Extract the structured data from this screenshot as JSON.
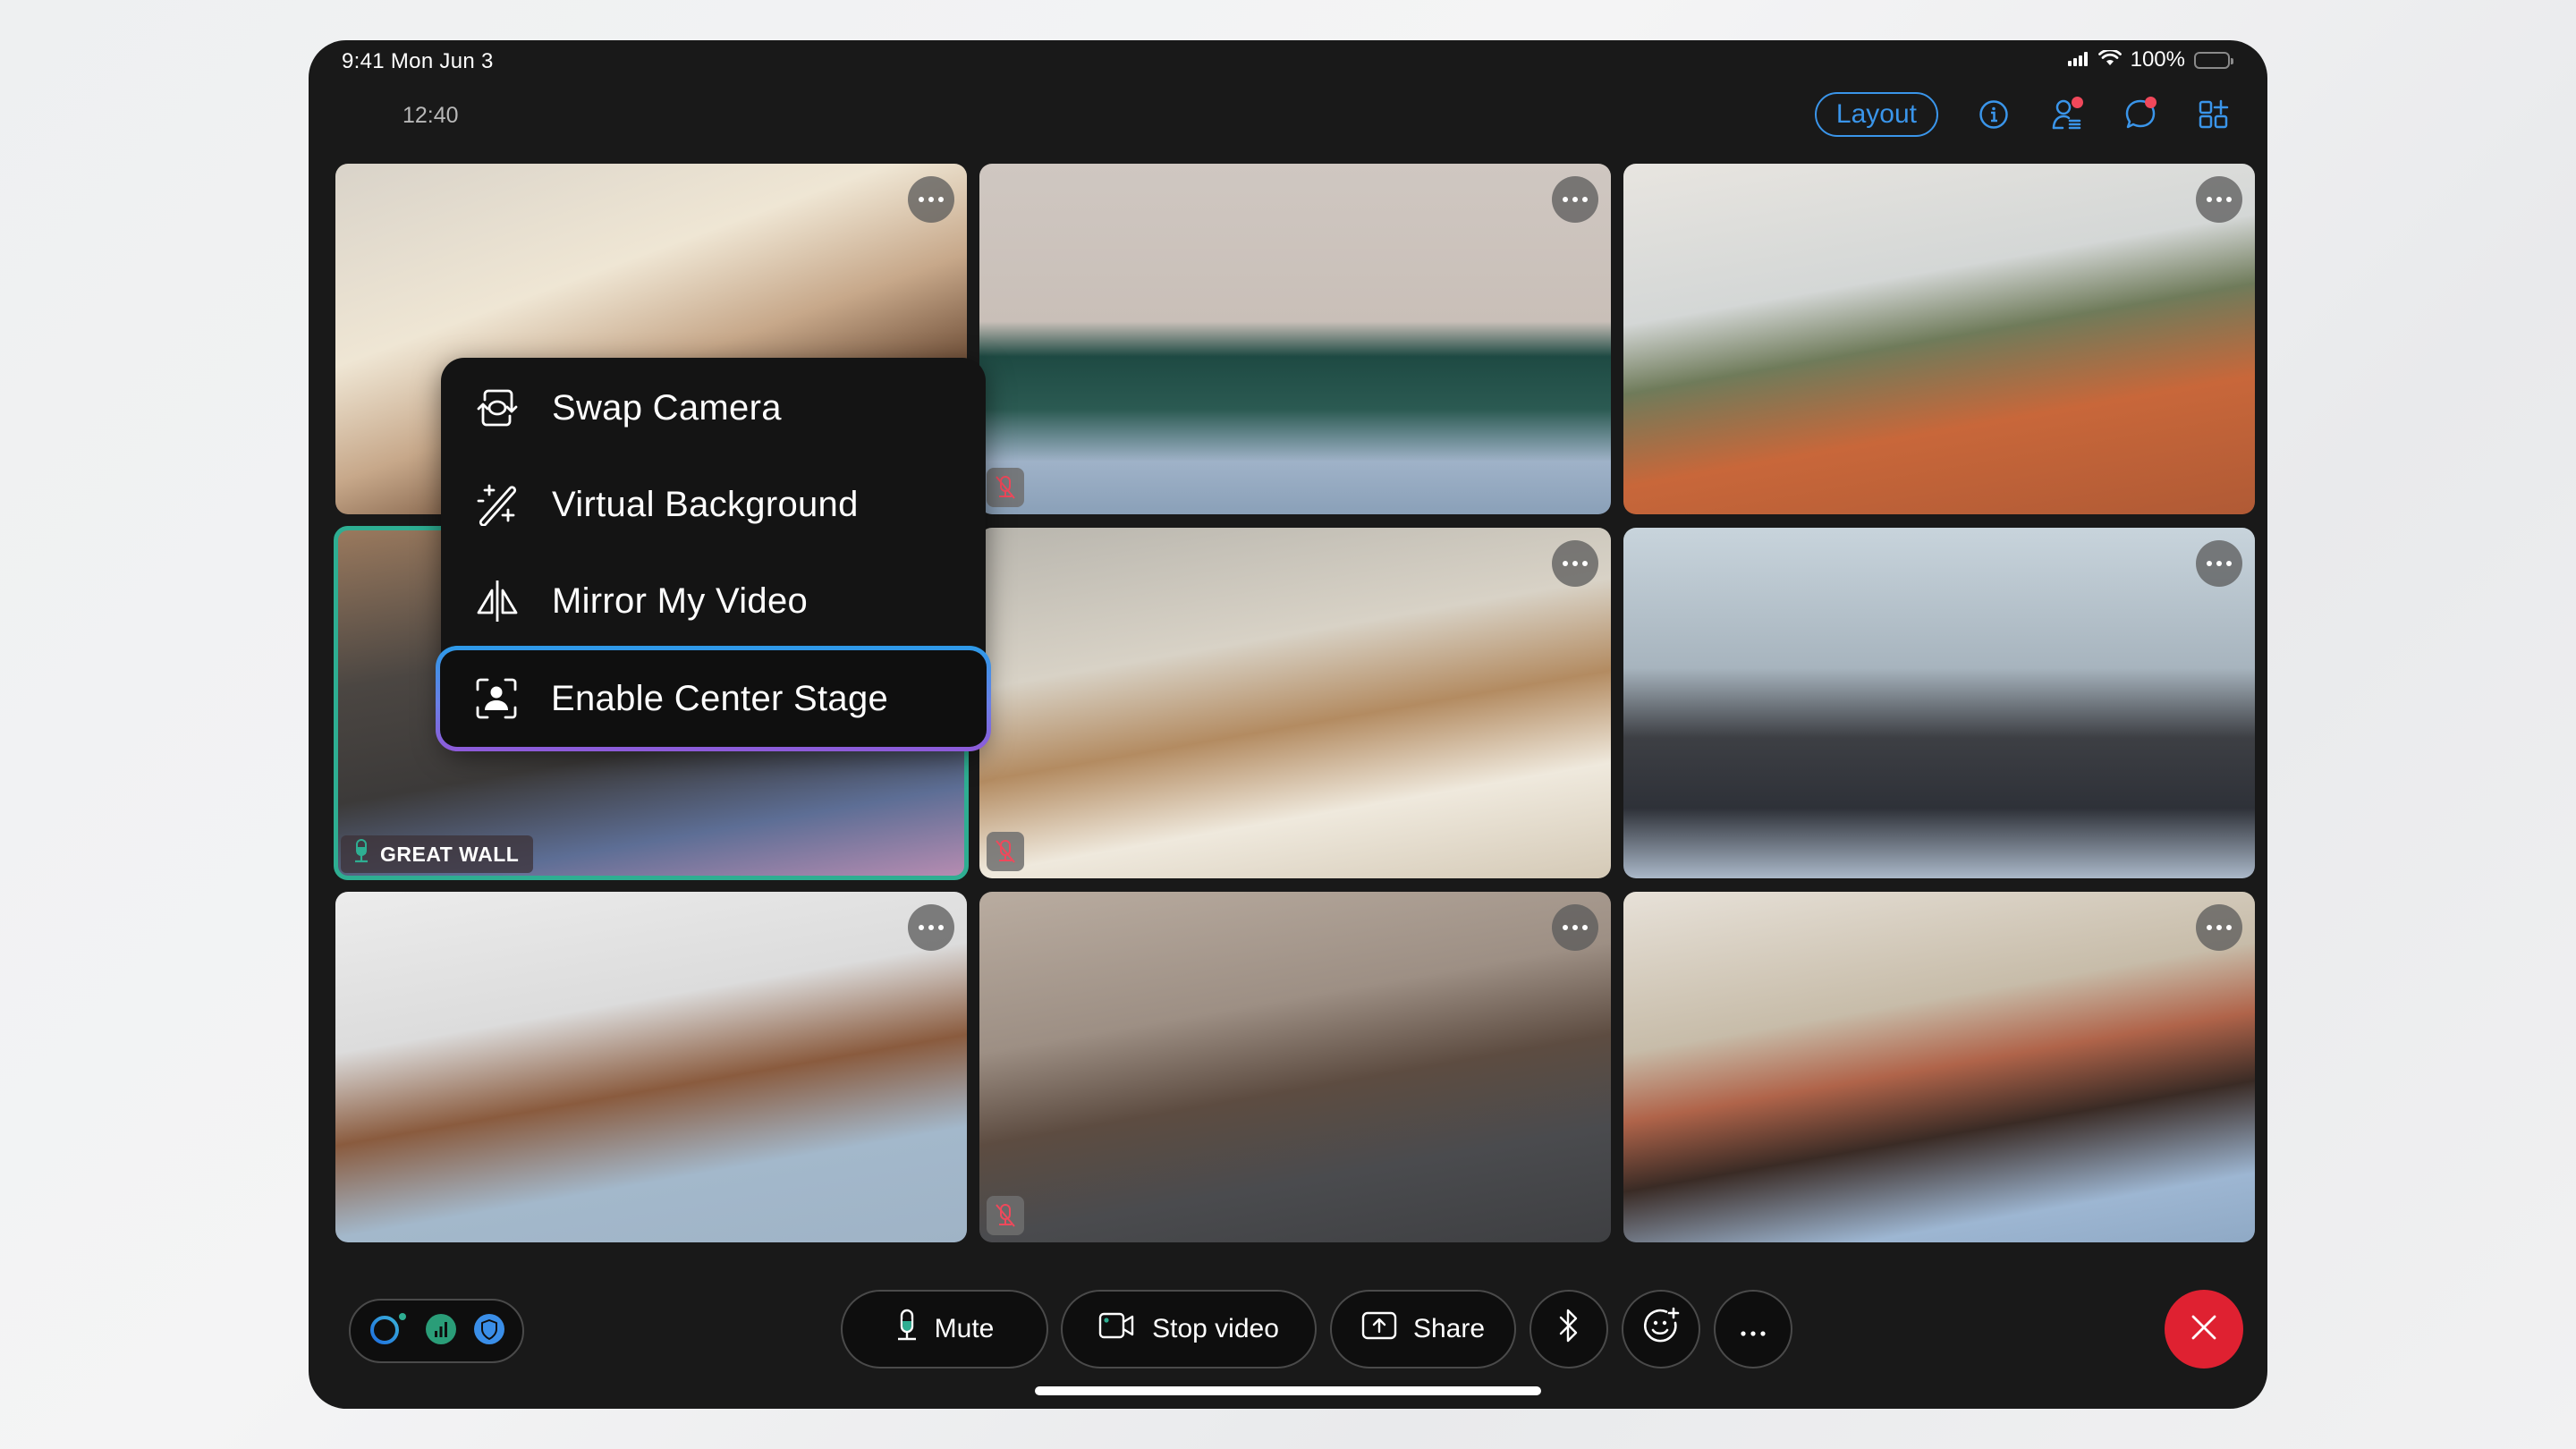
{
  "status_bar": {
    "time": "9:41  Mon Jun 3",
    "battery": "100%",
    "signal_icon": "cellular-signal-icon",
    "wifi_icon": "wifi-icon",
    "battery_icon": "battery-icon"
  },
  "meeting": {
    "elapsed": "12:40"
  },
  "topbar": {
    "layout_label": "Layout",
    "icons": [
      "info-icon",
      "participants-icon",
      "chat-icon",
      "apps-icon"
    ],
    "participants_badge": true,
    "chat_badge": true
  },
  "tiles": [
    {
      "id": 1,
      "muted": false,
      "active": false,
      "label": ""
    },
    {
      "id": 2,
      "muted": true,
      "active": false,
      "label": ""
    },
    {
      "id": 3,
      "muted": false,
      "active": false,
      "label": ""
    },
    {
      "id": 4,
      "muted": false,
      "active": true,
      "label": "GREAT WALL"
    },
    {
      "id": 5,
      "muted": true,
      "active": false,
      "label": ""
    },
    {
      "id": 6,
      "muted": false,
      "active": false,
      "label": ""
    },
    {
      "id": 7,
      "muted": false,
      "active": false,
      "label": ""
    },
    {
      "id": 8,
      "muted": true,
      "active": false,
      "label": ""
    },
    {
      "id": 9,
      "muted": false,
      "active": false,
      "label": ""
    }
  ],
  "context_menu": {
    "items": [
      {
        "label": "Swap Camera",
        "icon": "swap-camera-icon"
      },
      {
        "label": "Virtual Background",
        "icon": "magic-wand-icon"
      },
      {
        "label": "Mirror My Video",
        "icon": "mirror-icon"
      },
      {
        "label": "Enable Center Stage",
        "icon": "center-stage-icon",
        "highlighted": true
      }
    ]
  },
  "controls": {
    "mute_label": "Mute",
    "stop_video_label": "Stop video",
    "share_label": "Share",
    "bluetooth_icon": "bluetooth-icon",
    "reactions_icon": "reactions-icon",
    "more_icon": "more-icon",
    "end_call_icon": "close-icon"
  },
  "colors": {
    "accent_blue": "#3a95ea",
    "badge_red": "#f0485b",
    "end_call_red": "#df2131",
    "active_green": "#2eae92",
    "muted_red": "#f0485b"
  }
}
